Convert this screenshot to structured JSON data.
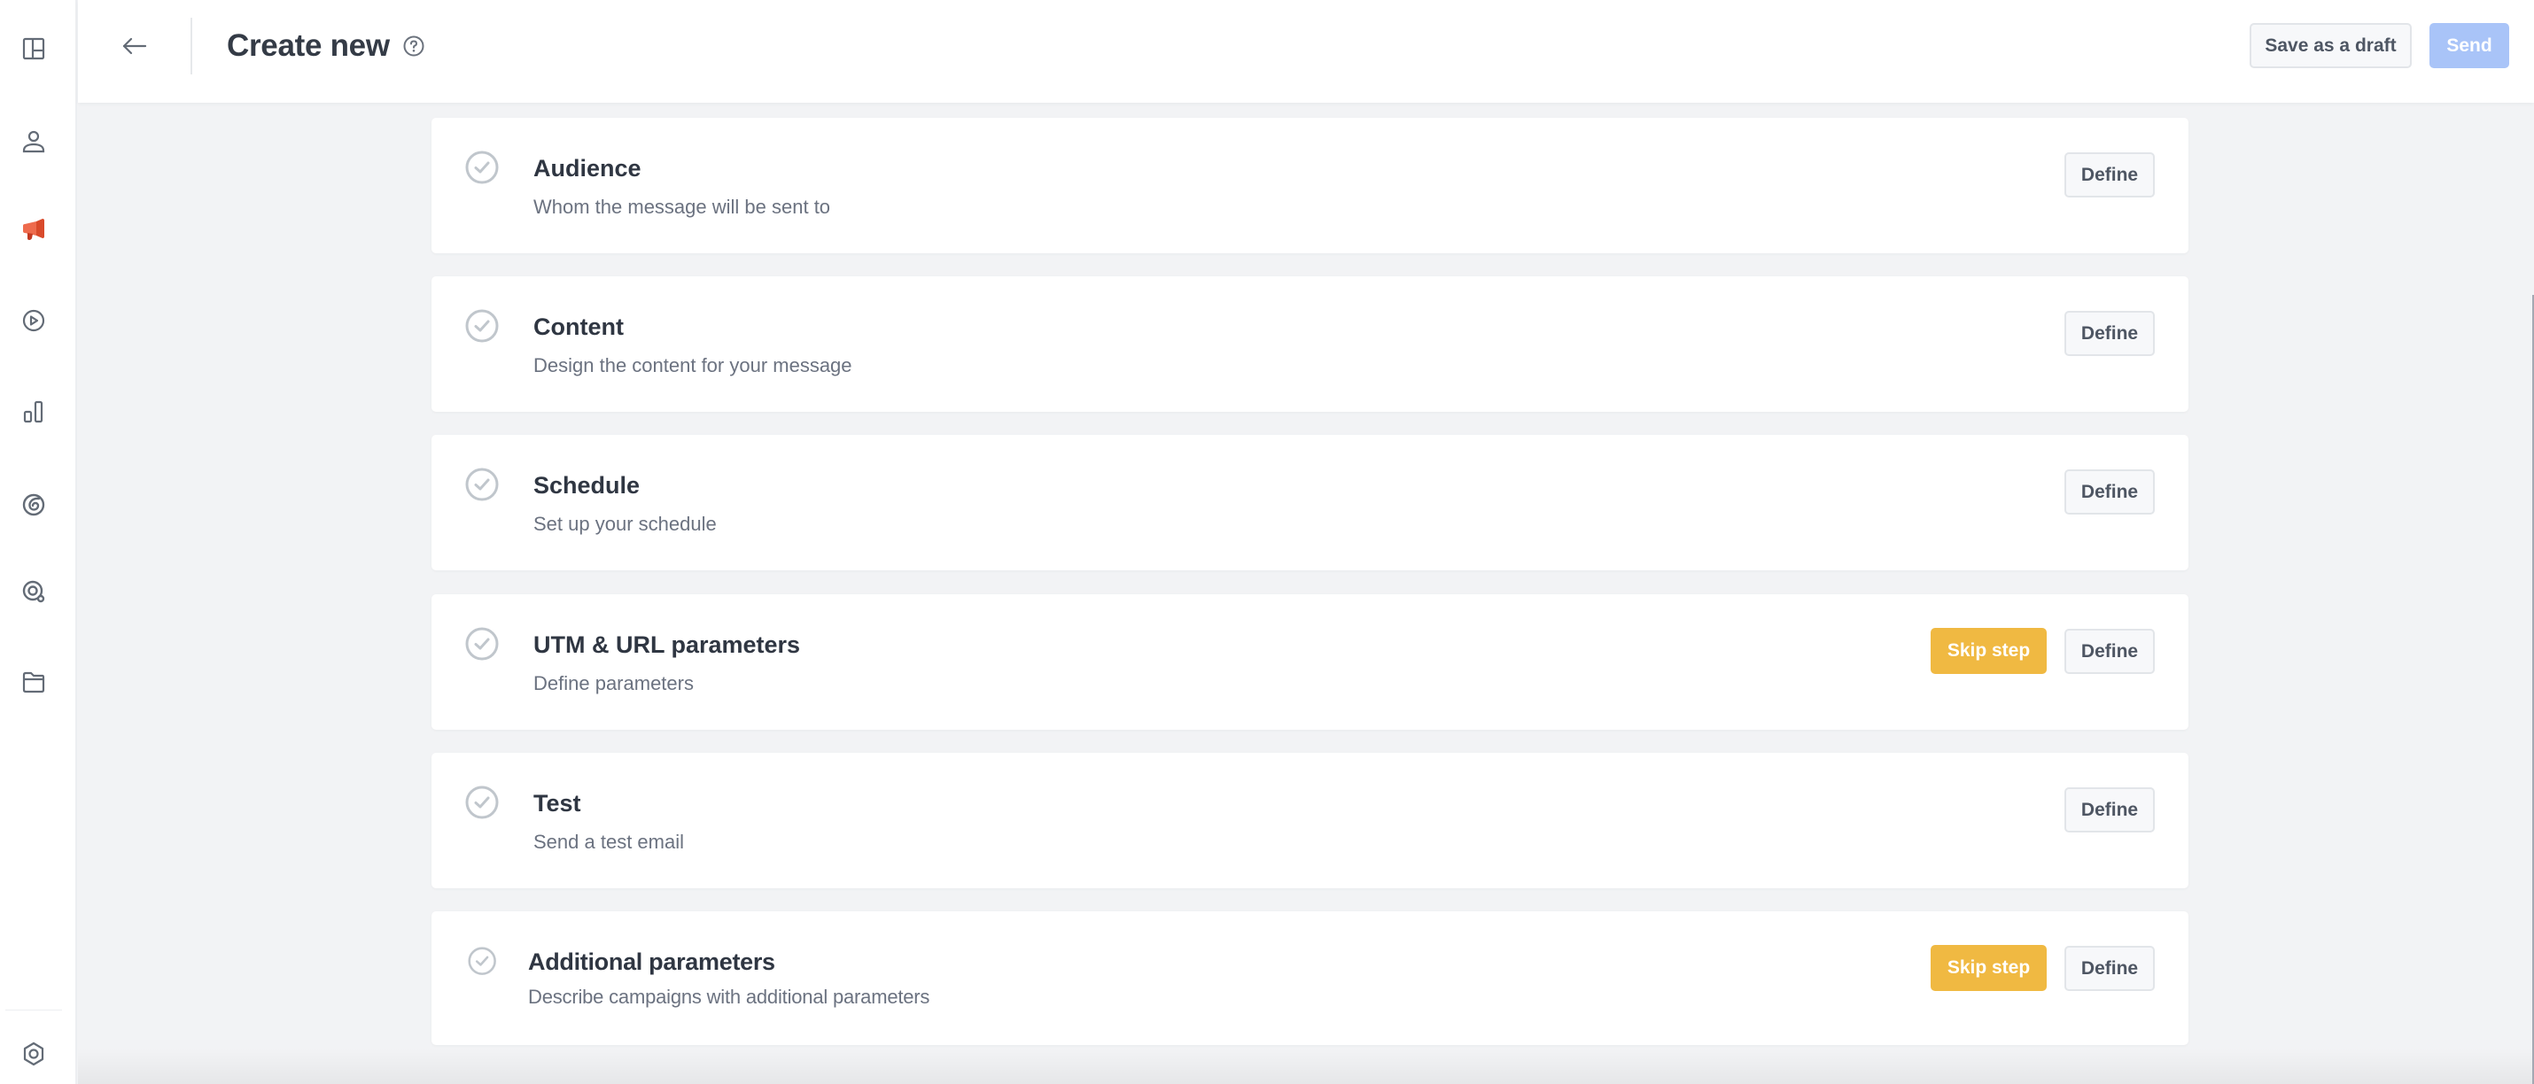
{
  "sidebar": {
    "items": [
      {
        "name": "dashboard-layout-icon",
        "label": "Dashboard"
      },
      {
        "name": "user-icon",
        "label": "Audience"
      },
      {
        "name": "megaphone-icon",
        "label": "Campaigns",
        "active": true
      },
      {
        "name": "play-circle-icon",
        "label": "Automation"
      },
      {
        "name": "bar-chart-icon",
        "label": "Analytics"
      },
      {
        "name": "swirl-icon",
        "label": "Integrations"
      },
      {
        "name": "search-target-icon",
        "label": "Insights"
      },
      {
        "name": "folder-icon",
        "label": "Files"
      }
    ],
    "settings": {
      "name": "settings-icon",
      "label": "Settings"
    }
  },
  "header": {
    "title": "Create new",
    "back_icon": "arrow-left-icon",
    "help_icon": "question-circle-icon",
    "save_draft_label": "Save as a draft",
    "send_label": "Send"
  },
  "steps": [
    {
      "title": "Audience",
      "subtitle": "Whom the message will be sent to",
      "define_label": "Define",
      "skip_label": null
    },
    {
      "title": "Content",
      "subtitle": "Design the content for your message",
      "define_label": "Define",
      "skip_label": null
    },
    {
      "title": "Schedule",
      "subtitle": "Set up your schedule",
      "define_label": "Define",
      "skip_label": null
    },
    {
      "title": "UTM & URL parameters",
      "subtitle": "Define parameters",
      "define_label": "Define",
      "skip_label": "Skip step"
    },
    {
      "title": "Test",
      "subtitle": "Send a test email",
      "define_label": "Define",
      "skip_label": null
    },
    {
      "title": "Additional parameters",
      "subtitle": "Describe campaigns with additional parameters",
      "define_label": "Define",
      "skip_label": "Skip step"
    }
  ],
  "colors": {
    "accent_active": "#e8583a",
    "send_disabled": "#a9c4f8",
    "skip_button": "#f0b942",
    "check_circle": "#c0c6cc",
    "background": "#f2f3f5"
  }
}
